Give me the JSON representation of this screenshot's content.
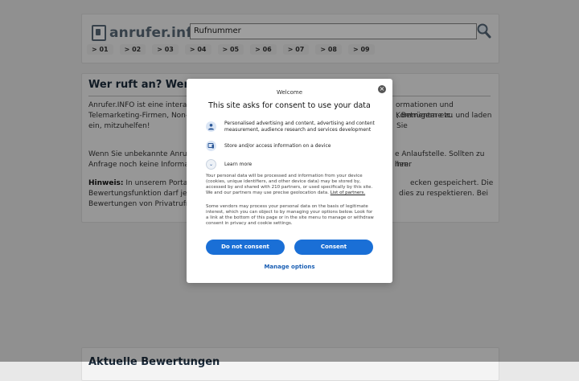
{
  "header": {
    "logo_text": "anrufer.info",
    "search_placeholder": "Rufnummer",
    "prefixes": [
      "> 01",
      "> 02",
      "> 03",
      "> 04",
      "> 05",
      "> 06",
      "> 07",
      "> 08",
      "> 09"
    ]
  },
  "content": {
    "title": "Wer ruft an? Wer ha",
    "p1_left": "Anrufer.INFO ist eine interaktiv",
    "p1_right": "ormationen und Kommentare zu",
    "p1_line2_left": "Telemarketing-Firmen, Non-Pro",
    "p1_line2_right": ", Betrügern etc. und laden Sie",
    "p1_line3": "ein, mitzuhelfen!",
    "p2_left": "Wenn Sie unbekannte Anrufe c",
    "p2_right": "e Anlaufstelle. Sollten zu ihrer",
    "p2_line2_left": "Anfrage noch keine Information",
    "p2_line2_right": "hen.",
    "hint_label": "Hinweis:",
    "p3_left": " In unserem Portal sin",
    "p3_right": "ecken gespeichert. Die",
    "p3_line2_left": "Bewertungsfunktion darf jedoc",
    "p3_line2_right": "dies zu respektieren. Bei",
    "p3_line3": "Bewertungen von Privatrufnum"
  },
  "bottom": {
    "title": "Aktuelle Bewertungen"
  },
  "consent": {
    "welcome": "Welcome",
    "title": "This site asks for consent to use your data",
    "purpose1": "Personalised advertising and content, advertising and content measurement, audience research and services development",
    "purpose2": "Store and/or access information on a device",
    "learn_more": "Learn more",
    "info1": "Your personal data will be processed and information from your device (cookies, unique identifiers, and other device data) may be stored by, accessed by and shared with 210 partners, or used specifically by this site. We and our partners may use precise geolocation data.",
    "info1_link": "List of partners.",
    "info2": "Some vendors may process your personal data on the basis of legitimate interest, which you can object to by managing your options below. Look for a link at the bottom of this page or in the site menu to manage or withdraw consent in privacy and cookie settings.",
    "do_not_consent": "Do not consent",
    "consent": "Consent",
    "manage_options": "Manage options",
    "close_symbol": "×"
  },
  "colors": {
    "primary_button": "#1a6fd6",
    "link": "#1a5fb4",
    "logo": "#5a6a78"
  }
}
